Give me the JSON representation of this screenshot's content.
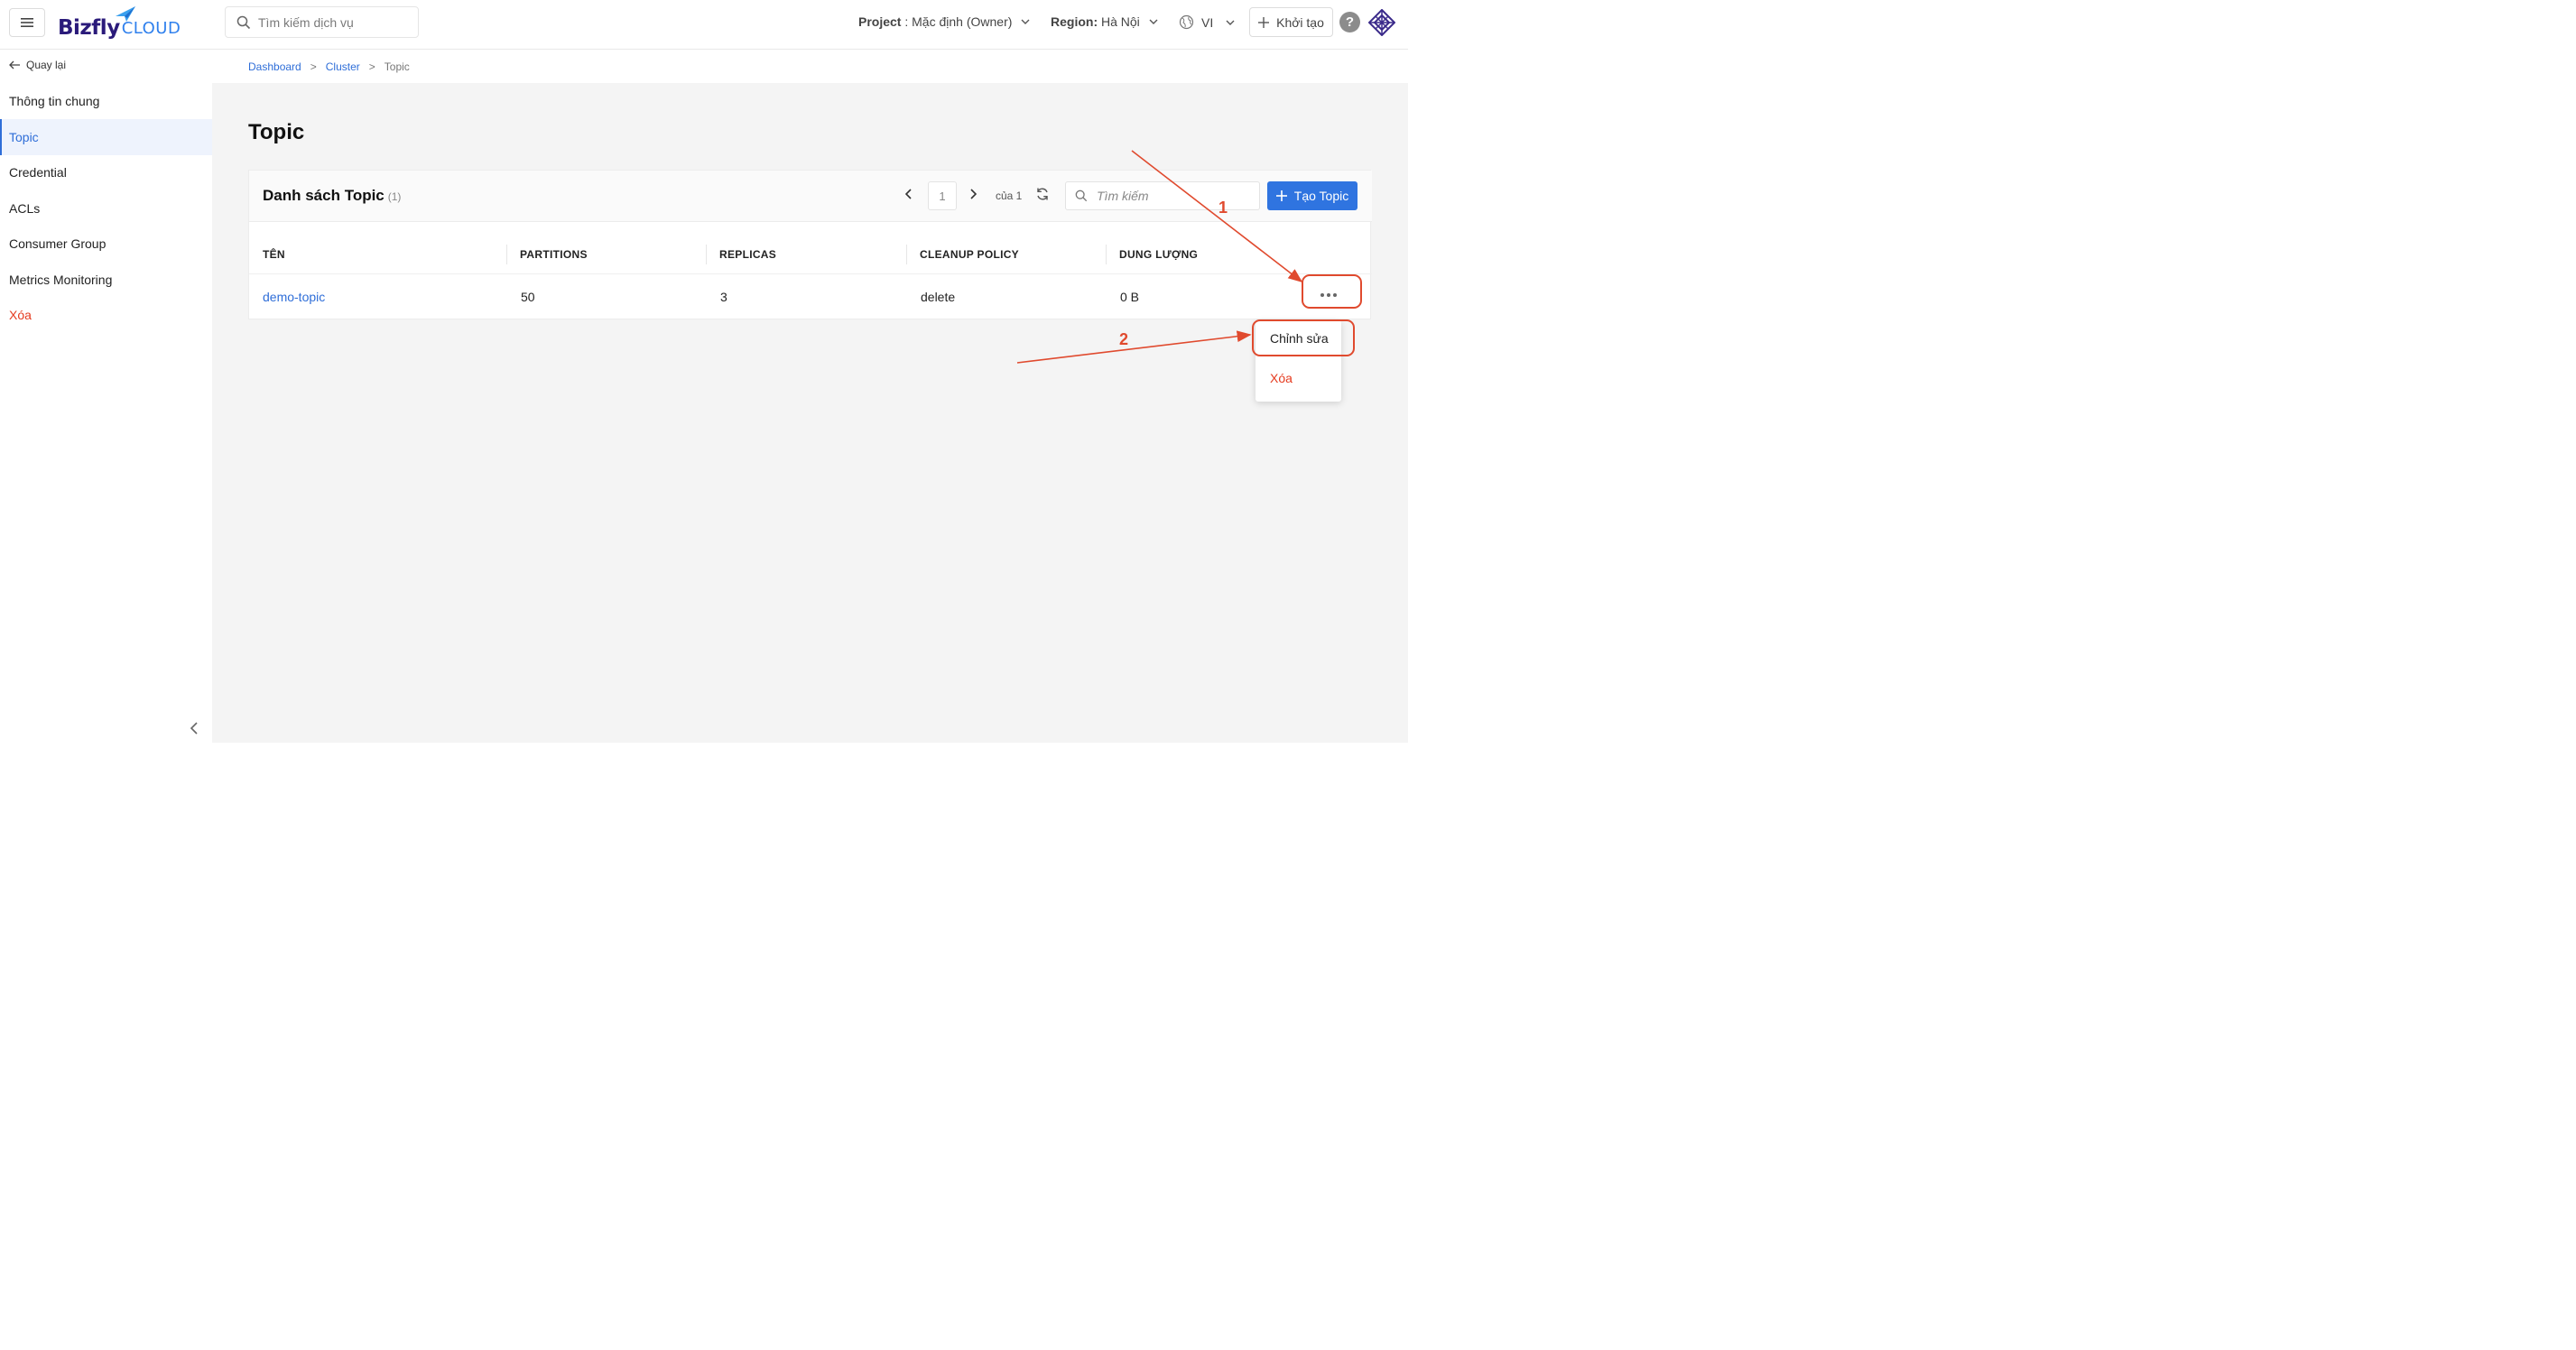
{
  "header": {
    "logo_main": "Bizfly",
    "logo_sub": "CLOUD",
    "search_placeholder": "Tìm kiếm dịch vụ",
    "project_label": "Project",
    "project_value": " : Mặc định (Owner)",
    "region_label": "Region:",
    "region_value": " Hà Nội",
    "language": "VI",
    "create_label": "Khởi tạo",
    "help_label": "?"
  },
  "sidebar": {
    "back_label": "Quay lại",
    "items": [
      {
        "label": "Thông tin chung"
      },
      {
        "label": "Topic"
      },
      {
        "label": "Credential"
      },
      {
        "label": "ACLs"
      },
      {
        "label": "Consumer Group"
      },
      {
        "label": "Metrics Monitoring"
      },
      {
        "label": "Xóa"
      }
    ]
  },
  "breadcrumb": {
    "items": [
      "Dashboard",
      "Cluster",
      "Topic"
    ],
    "separator": ">"
  },
  "page": {
    "title": "Topic"
  },
  "card": {
    "title": "Danh sách Topic",
    "count": "(1)",
    "pagination": {
      "current_page": "1",
      "of_text": "của 1"
    },
    "search_placeholder": "Tìm kiếm",
    "create_button": "Tạo Topic"
  },
  "table": {
    "columns": [
      "TÊN",
      "PARTITIONS",
      "REPLICAS",
      "CLEANUP POLICY",
      "DUNG LƯỢNG"
    ],
    "rows": [
      {
        "name": "demo-topic",
        "partitions": "50",
        "replicas": "3",
        "cleanup_policy": "delete",
        "size": "0 B"
      }
    ]
  },
  "row_menu": {
    "items": [
      {
        "label": "Chỉnh sửa"
      },
      {
        "label": "Xóa"
      }
    ]
  },
  "annotations": {
    "step1": "1",
    "step2": "2",
    "color": "#e04a2e"
  },
  "colors": {
    "primary": "#2f74e0",
    "link": "#2f6ed8",
    "danger": "#e53a1e",
    "brand": "#2a1a7a"
  }
}
